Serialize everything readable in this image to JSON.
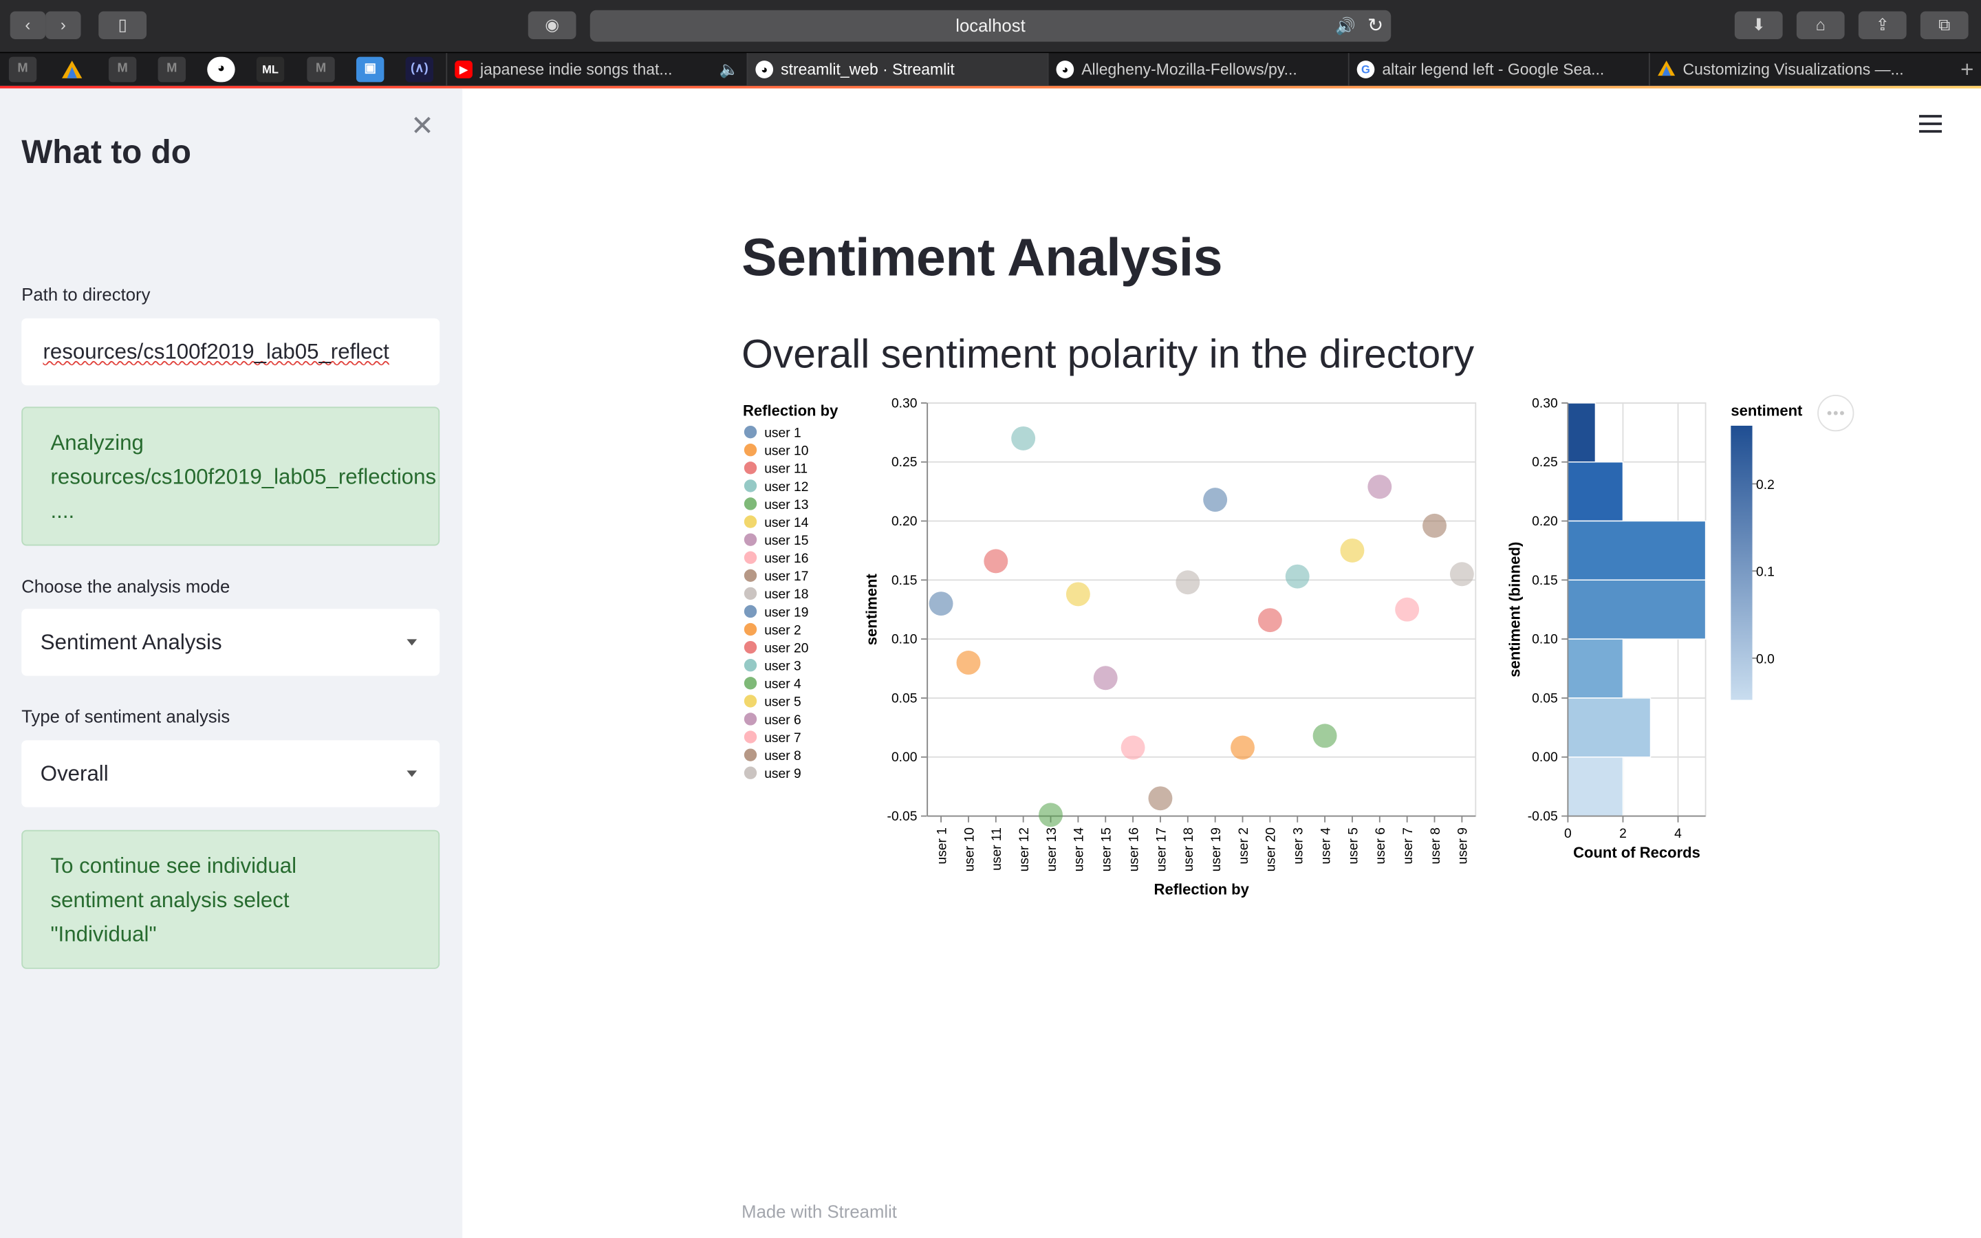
{
  "browser": {
    "url": "localhost",
    "tabs": [
      {
        "title": "japanese indie songs that..."
      },
      {
        "title": "streamlit_web · Streamlit"
      },
      {
        "title": "Allegheny-Mozilla-Fellows/py..."
      },
      {
        "title": "altair legend left - Google Sea..."
      },
      {
        "title": "Customizing Visualizations —..."
      }
    ],
    "pinned_labels": [
      "M",
      "M",
      "M",
      "ML",
      "M"
    ]
  },
  "sidebar": {
    "title": "What to do",
    "path_label": "Path to directory",
    "path_value": "resources/cs100f2019_lab05_reflect",
    "analyzing_line1": "Analyzing",
    "analyzing_line2": "resources/cs100f2019_lab05_reflections",
    "analyzing_line3": "....",
    "mode_label": "Choose the analysis mode",
    "mode_value": "Sentiment Analysis",
    "type_label": "Type of sentiment analysis",
    "type_value": "Overall",
    "hint_line1": "To continue see individual",
    "hint_line2": "sentiment analysis select",
    "hint_line3": "\"Individual\""
  },
  "main": {
    "title": "Sentiment Analysis",
    "subtitle": "Overall sentiment polarity in the directory",
    "footer": "Made with Streamlit"
  },
  "chart_data": [
    {
      "type": "scatter",
      "legend_title": "Reflection by",
      "legend_position": "left",
      "xlabel": "Reflection by",
      "ylabel": "sentiment",
      "ylim": [
        -0.05,
        0.3
      ],
      "yticks": [
        "0.30",
        "0.25",
        "0.20",
        "0.15",
        "0.10",
        "0.05",
        "0.00",
        "-0.05"
      ],
      "grid": true,
      "categories": [
        "user 1",
        "user 10",
        "user 11",
        "user 12",
        "user 13",
        "user 14",
        "user 15",
        "user 16",
        "user 17",
        "user 18",
        "user 19",
        "user 2",
        "user 20",
        "user 3",
        "user 4",
        "user 5",
        "user 6",
        "user 7",
        "user 8",
        "user 9"
      ],
      "values": [
        0.13,
        0.08,
        0.166,
        0.27,
        -0.049,
        0.138,
        0.067,
        0.008,
        -0.035,
        0.148,
        0.218,
        0.008,
        0.116,
        0.153,
        0.018,
        0.175,
        0.229,
        0.125,
        0.196,
        0.155
      ],
      "legend_order": [
        "user 1",
        "user 10",
        "user 11",
        "user 12",
        "user 13",
        "user 14",
        "user 15",
        "user 16",
        "user 17",
        "user 18",
        "user 19",
        "user 2",
        "user 20",
        "user 3",
        "user 4",
        "user 5",
        "user 6",
        "user 7",
        "user 8",
        "user 9"
      ],
      "colors": {
        "user 1": "#4c78a8",
        "user 10": "#f58518",
        "user 11": "#e45756",
        "user 12": "#72b7b2",
        "user 13": "#54a24b",
        "user 14": "#eeca3b",
        "user 15": "#b279a2",
        "user 16": "#ff9da6",
        "user 17": "#9d755d",
        "user 18": "#bab0ac",
        "user 19": "#4c78a8",
        "user 2": "#f58518",
        "user 20": "#e45756",
        "user 3": "#72b7b2",
        "user 4": "#54a24b",
        "user 5": "#eeca3b",
        "user 6": "#b279a2",
        "user 7": "#ff9da6",
        "user 8": "#9d755d",
        "user 9": "#bab0ac"
      }
    },
    {
      "type": "bar",
      "orientation": "horizontal",
      "xlabel": "Count of Records",
      "ylabel": "sentiment (binned)",
      "xticks": [
        "0",
        "2",
        "4"
      ],
      "xlim": [
        0,
        5
      ],
      "ylim": [
        -0.05,
        0.3
      ],
      "bins": [
        {
          "from": 0.25,
          "to": 0.3,
          "count": 1,
          "color": "#1f4e92"
        },
        {
          "from": 0.2,
          "to": 0.25,
          "count": 2,
          "color": "#2a67b1"
        },
        {
          "from": 0.15,
          "to": 0.2,
          "count": 5,
          "color": "#3f7fbf"
        },
        {
          "from": 0.1,
          "to": 0.15,
          "count": 5,
          "color": "#5591c8"
        },
        {
          "from": 0.05,
          "to": 0.1,
          "count": 2,
          "color": "#78acd6"
        },
        {
          "from": 0.0,
          "to": 0.05,
          "count": 3,
          "color": "#a9cbe5"
        },
        {
          "from": -0.05,
          "to": 0.0,
          "count": 2,
          "color": "#cbdff0"
        }
      ],
      "color_legend": {
        "title": "sentiment",
        "ticks": [
          "0.2",
          "0.1",
          "0.0"
        ],
        "gradient": [
          "#1f4e92",
          "#c9ddef"
        ]
      }
    }
  ]
}
